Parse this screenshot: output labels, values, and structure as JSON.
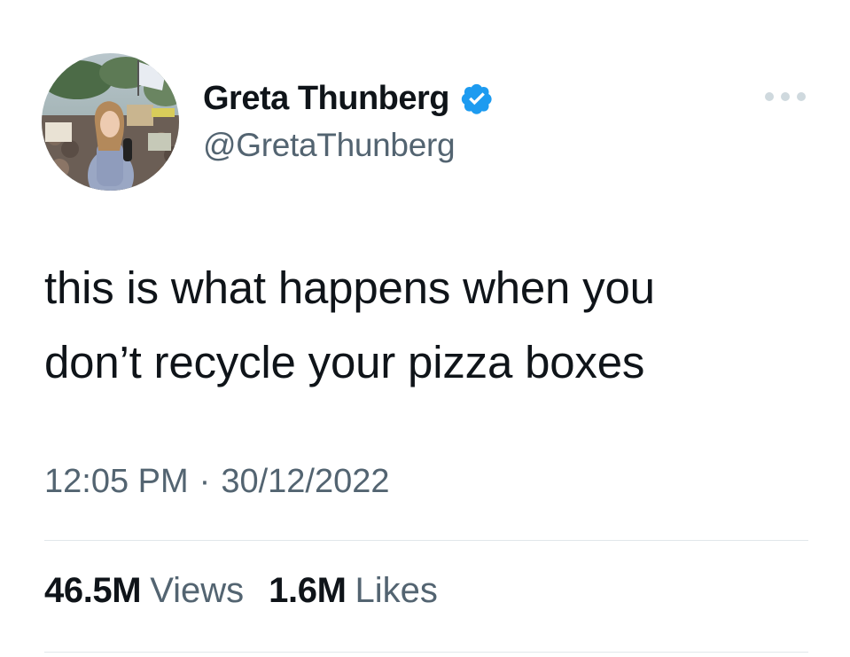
{
  "author": {
    "display_name": "Greta Thunberg",
    "handle": "@GretaThunberg",
    "verified_icon": "verified-badge-icon",
    "avatar_icon": "profile-photo-avatar"
  },
  "menu": {
    "more_icon": "more-options-icon"
  },
  "tweet": {
    "text_line_1": "this is what happens when you",
    "text_line_2": "don’t recycle your pizza boxes",
    "time": "12:05 PM",
    "separator": "·",
    "date": "30/12/2022"
  },
  "stats": {
    "views_value": "46.5M",
    "views_label": "Views",
    "likes_value": "1.6M",
    "likes_label": "Likes"
  },
  "colors": {
    "text_primary": "#0f1419",
    "text_secondary": "#536471",
    "verified_blue": "#1d9bf0",
    "divider": "#e1e7ea"
  }
}
